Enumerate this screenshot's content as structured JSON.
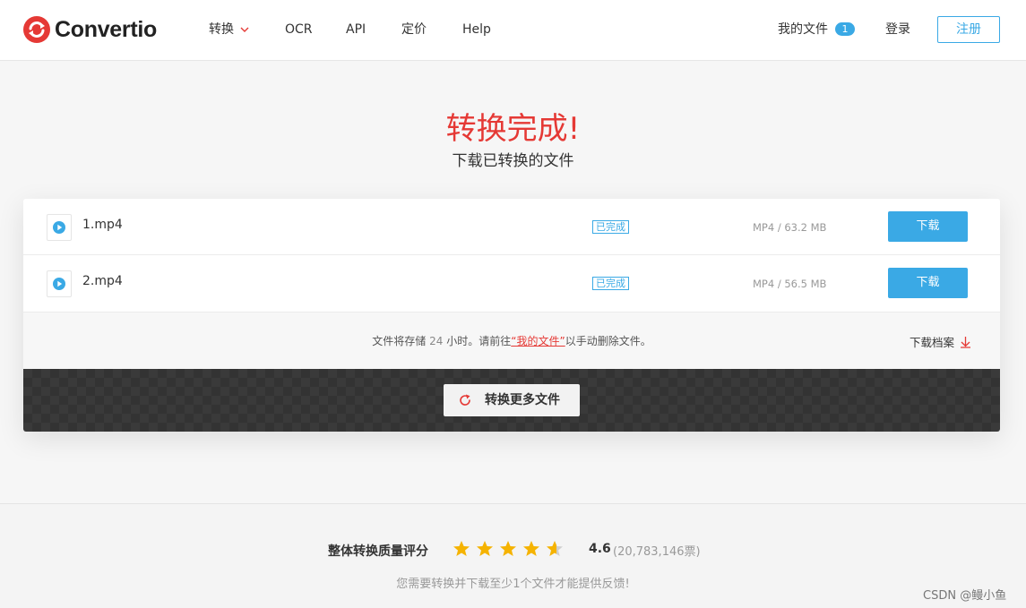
{
  "header": {
    "brand": "Convertio",
    "nav": {
      "convert": "转换",
      "ocr": "OCR",
      "api": "API",
      "pricing": "定价",
      "help": "Help"
    },
    "my_files": "我的文件",
    "my_files_count": "1",
    "login": "登录",
    "register": "注册"
  },
  "main": {
    "title": "转换完成!",
    "subtitle": "下载已转换的文件"
  },
  "files": [
    {
      "name": "1.mp4",
      "status": "已完成",
      "meta": "MP4 / 63.2 MB",
      "download": "下载"
    },
    {
      "name": "2.mp4",
      "status": "已完成",
      "meta": "MP4 / 56.5 MB",
      "download": "下载"
    }
  ],
  "info": {
    "prefix": "文件将存储",
    "hours": "24",
    "middle": "小时。请前往",
    "link": "“我的文件”",
    "suffix": "以手动删除文件。",
    "archive": "下载档案"
  },
  "convert_more": "转换更多文件",
  "rating": {
    "label": "整体转换质量评分",
    "score": "4.6",
    "stars": 4.6,
    "votes": "(20,783,146票)",
    "feedback": "您需要转换并下载至少1个文件才能提供反馈!"
  },
  "watermark": "CSDN @鳗小鱼",
  "colors": {
    "accent": "#3aa9e5",
    "brand_red": "#e53935",
    "star": "#f5b301"
  }
}
